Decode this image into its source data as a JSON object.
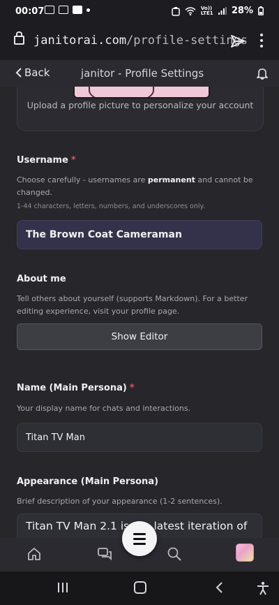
{
  "status": {
    "time": "00:07",
    "battery": "28%",
    "network": "Vo)) LTE1"
  },
  "browser": {
    "url_host": "janitorai.com",
    "url_path": "/profile-settings"
  },
  "header": {
    "back_label": "Back",
    "title": "janitor - Profile Settings"
  },
  "profile_picture": {
    "caption": "Upload a profile picture to personalize your account"
  },
  "username": {
    "label": "Username",
    "required_mark": "*",
    "help_part1": "Choose carefully - usernames are ",
    "help_bold": "permanent",
    "help_part2": " and cannot be changed.",
    "rule": "1-44 characters, letters, numbers, and underscores only.",
    "value": "The Brown Coat Cameraman"
  },
  "about": {
    "label": "About me",
    "help": "Tell others about yourself (supports Markdown). For a better editing experience, visit your profile page.",
    "editor_button": "Show Editor"
  },
  "persona_name": {
    "label": "Name (Main Persona)",
    "required_mark": "*",
    "help": "Your display name for chats and interactions.",
    "value": "Titan TV Man"
  },
  "appearance": {
    "label": "Appearance (Main Persona)",
    "help": "Brief description of your appearance (1-2 sentences).",
    "value": "Titan TV Man 2.1 is the latest iteration of"
  },
  "bottom_nav": {
    "items": [
      "home-icon",
      "chats-icon",
      "menu-icon",
      "search-icon",
      "avatar"
    ]
  },
  "system_nav": {
    "items": [
      "recents-icon",
      "home-button-icon",
      "back-icon",
      "accessibility-icon"
    ]
  },
  "colors": {
    "background": "#26262b",
    "required": "#e0525f",
    "username_field": "#34324a"
  }
}
